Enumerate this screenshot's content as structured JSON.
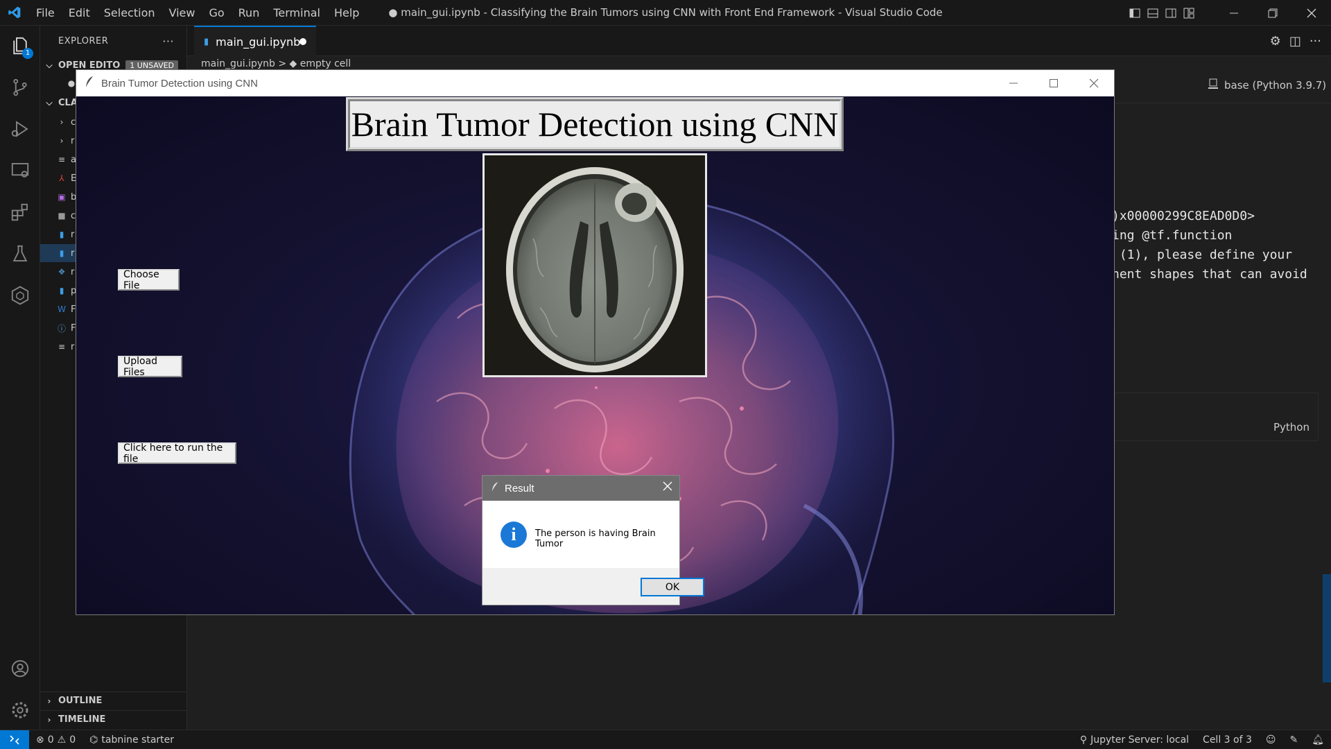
{
  "vscode": {
    "menu": [
      "File",
      "Edit",
      "Selection",
      "View",
      "Go",
      "Run",
      "Terminal",
      "Help"
    ],
    "window_title": "● main_gui.ipynb - Classifying the Brain Tumors using CNN with Front End Framework - Visual Studio Code",
    "explorer_badge": "1",
    "sidebar": {
      "title": "EXPLORER",
      "more": "···",
      "open_editors_label": "OPEN EDITO",
      "unsaved_badge": "1 UNSAVED",
      "folder_label": "CLA",
      "items": [
        "c",
        "r",
        "a",
        "E",
        "b",
        "c",
        "r",
        "r",
        "r",
        "p",
        "F",
        "F",
        "r"
      ],
      "outline": "OUTLINE",
      "timeline": "TIMELINE"
    },
    "tab": {
      "label": "main_gui.ipynb"
    },
    "breadcrumb": "main_gui.ipynb > ◆ empty cell",
    "kernel": "base (Python 3.9.7)",
    "output_lines": [
      ")x00000299C8EAD0D0>",
      "ing @tf.function",
      " (1), please define your",
      "nent shapes that can avoid"
    ],
    "cell_language": "Python",
    "status": {
      "errors": "0",
      "warnings": "0",
      "tabnine": "tabnine starter",
      "jupyter": "Jupyter Server: local",
      "cell": "Cell 3 of 3"
    },
    "colors": {
      "accent": "#0078d4",
      "background": "#1f1f1f",
      "chrome": "#181818"
    }
  },
  "app": {
    "window_title": "Brain Tumor Detection using CNN",
    "heading": "Brain Tumor Detection using CNN",
    "buttons": {
      "choose": "Choose File",
      "upload": "Upload Files",
      "run": "Click here to run the file"
    }
  },
  "dialog": {
    "title": "Result",
    "message": "The person is having Brain Tumor",
    "ok": "OK",
    "icon": "info-icon"
  }
}
